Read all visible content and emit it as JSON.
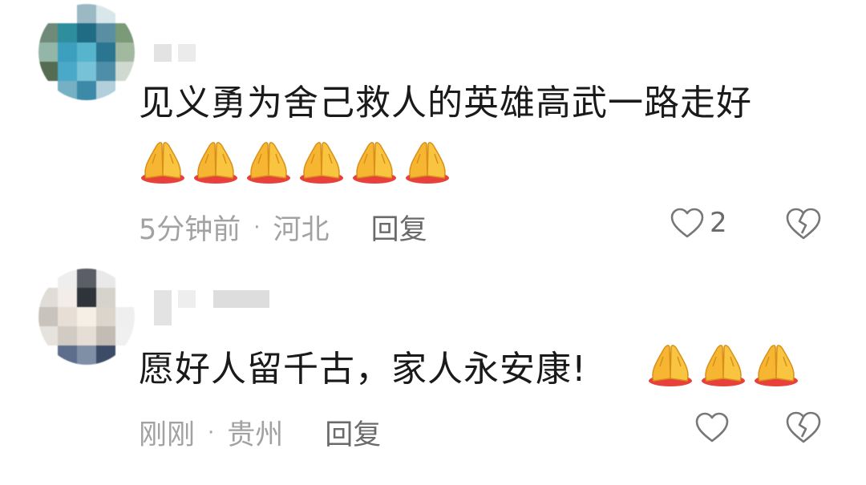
{
  "comments": [
    {
      "text": "见义勇为舍己救人的英雄高武一路走好",
      "emoji": [
        "pray-hands",
        "pray-hands",
        "pray-hands",
        "pray-hands",
        "pray-hands",
        "pray-hands"
      ],
      "time": "5分钟前",
      "separator": "·",
      "location": "河北",
      "reply_label": "回复",
      "like_count": "2",
      "icons": {
        "like": "heart-outline-icon",
        "dislike": "broken-heart-icon"
      }
    },
    {
      "text": "愿好人留千古，家人永安康!",
      "emoji": [
        "pray-hands",
        "pray-hands",
        "pray-hands"
      ],
      "time": "刚刚",
      "separator": "·",
      "location": "贵州",
      "reply_label": "回复",
      "icons": {
        "like": "heart-outline-icon",
        "dislike": "broken-heart-icon"
      }
    }
  ],
  "colors": {
    "text": "#1a1a1a",
    "meta": "#a2a2a2",
    "reply": "#6a6a6a",
    "emoji": "#f7b632"
  }
}
